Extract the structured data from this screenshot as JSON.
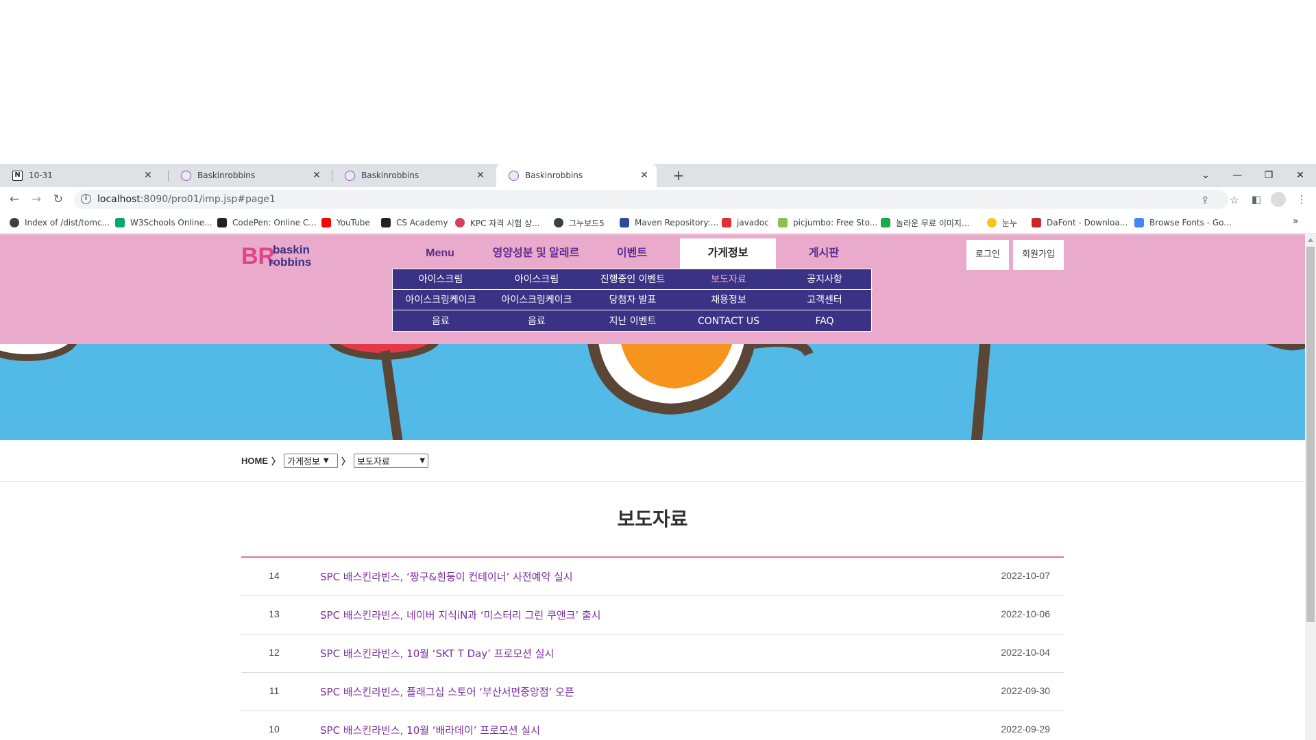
{
  "browser": {
    "tabs": [
      {
        "title": "10-31",
        "favicon": "notion-icon",
        "active": false
      },
      {
        "title": "Baskinrobbins",
        "favicon": "baskin-favicon",
        "active": false
      },
      {
        "title": "Baskinrobbins",
        "favicon": "baskin-favicon",
        "active": false
      },
      {
        "title": "Baskinrobbins",
        "favicon": "baskin-favicon",
        "active": true
      }
    ],
    "url_host": "localhost",
    "url_rest": ":8090/pro01/imp.jsp#page1",
    "bookmarks": [
      {
        "label": "Index of /dist/tomc...",
        "color": "#3c4043"
      },
      {
        "label": "W3Schools Online...",
        "color": "#04aa6d"
      },
      {
        "label": "CodePen: Online C...",
        "color": "#222222"
      },
      {
        "label": "YouTube",
        "color": "#ff0000"
      },
      {
        "label": "CS Academy",
        "color": "#222222"
      },
      {
        "label": "KPC 자격 시험 상...",
        "color": "#d93f5a"
      },
      {
        "label": "그누보드5",
        "color": "#3c4043"
      },
      {
        "label": "Maven Repository:...",
        "color": "#2f4c9b"
      },
      {
        "label": "javadoc",
        "color": "#e03030"
      },
      {
        "label": "picjumbo: Free Sto...",
        "color": "#8bc34a"
      },
      {
        "label": "놀라운 무료 이미지...",
        "color": "#1ba94c"
      },
      {
        "label": "눈누",
        "color": "#f5c518"
      },
      {
        "label": "DaFont - Downloa...",
        "color": "#c62828"
      },
      {
        "label": "Browse Fonts - Go...",
        "color": "#4285f4"
      }
    ]
  },
  "site": {
    "logo_text_1": "baskin",
    "logo_text_2": "robbins",
    "logo_br": "BR",
    "gnb": [
      {
        "label": "Menu",
        "active": false
      },
      {
        "label": "영양성분 및 알레르기",
        "active": false
      },
      {
        "label": "이벤트",
        "active": false
      },
      {
        "label": "가게정보",
        "active": true
      },
      {
        "label": "게시판",
        "active": false
      }
    ],
    "dropdown": [
      [
        "아이스크림",
        "아이스크림",
        "진행중인 이벤트",
        "보도자료",
        "공지사항"
      ],
      [
        "아이스크림케이크",
        "아이스크림케이크",
        "당첨자 발표",
        "채용정보",
        "고객센터"
      ],
      [
        "음료",
        "음료",
        "지난 이벤트",
        "CONTACT US",
        "FAQ"
      ]
    ],
    "login": "로그인",
    "signup": "회원가입"
  },
  "breadcrumb": {
    "home": "HOME",
    "select1": "가게정보",
    "select2": "보도자료"
  },
  "page_title": "보도자료",
  "posts": [
    {
      "num": "14",
      "subject": "SPC 배스킨라빈스, ‘짱구&흰둥이 컨테이너’ 사전예약 실시",
      "date": "2022-10-07"
    },
    {
      "num": "13",
      "subject": "SPC 배스킨라빈스, 네이버 지식iN과 ‘미스터리 그린 쿠앤크’ 출시",
      "date": "2022-10-06"
    },
    {
      "num": "12",
      "subject": "SPC 배스킨라빈스, 10월 ‘SKT T Day’ 프로모션 실시",
      "date": "2022-10-04"
    },
    {
      "num": "11",
      "subject": "SPC 배스킨라빈스, 플래그십 스토어 ‘부산서면중앙점’ 오픈",
      "date": "2022-09-30"
    },
    {
      "num": "10",
      "subject": "SPC 배스킨라빈스, 10월 ‘배라데이’ 프로모션 실시",
      "date": "2022-09-29"
    }
  ],
  "colors": {
    "header_pink": "#e9aacb",
    "nav_purple": "#3a3284",
    "banner_blue": "#53b9e7",
    "accent_pink": "#e0748f",
    "link_purple": "#7b2da3"
  }
}
